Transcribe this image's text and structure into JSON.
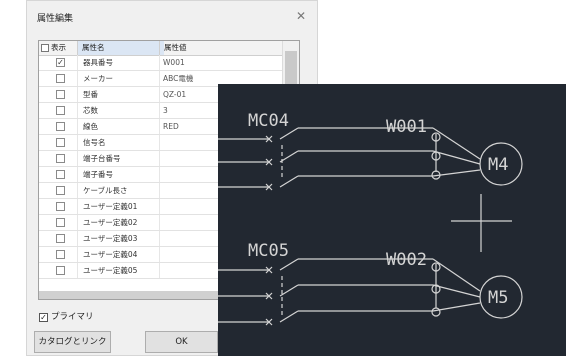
{
  "dialog": {
    "title": "属性編集",
    "close_glyph": "✕",
    "table": {
      "columns": [
        "表示",
        "属性名",
        "属性値"
      ],
      "rows": [
        {
          "checked": true,
          "name": "器具番号",
          "value": "W001"
        },
        {
          "checked": false,
          "name": "メーカー",
          "value": "ABC電機"
        },
        {
          "checked": false,
          "name": "型番",
          "value": "QZ-01"
        },
        {
          "checked": false,
          "name": "芯数",
          "value": "3"
        },
        {
          "checked": false,
          "name": "線色",
          "value": "RED"
        },
        {
          "checked": false,
          "name": "信号名",
          "value": ""
        },
        {
          "checked": false,
          "name": "端子台番号",
          "value": ""
        },
        {
          "checked": false,
          "name": "端子番号",
          "value": ""
        },
        {
          "checked": false,
          "name": "ケーブル長さ",
          "value": ""
        },
        {
          "checked": false,
          "name": "ユーザー定義01",
          "value": ""
        },
        {
          "checked": false,
          "name": "ユーザー定義02",
          "value": ""
        },
        {
          "checked": false,
          "name": "ユーザー定義03",
          "value": ""
        },
        {
          "checked": false,
          "name": "ユーザー定義04",
          "value": ""
        },
        {
          "checked": false,
          "name": "ユーザー定義05",
          "value": ""
        }
      ]
    },
    "primary_label": "プライマリ",
    "primary_checked": true,
    "catalog_button": "カタログとリンク",
    "ok_button": "OK"
  },
  "cad": {
    "labels": {
      "mc04": "MC04",
      "w001": "W001",
      "m4": "M4",
      "mc05": "MC05",
      "w002": "W002",
      "m5": "M5"
    },
    "colors": {
      "background": "#222831",
      "lines": "#d4d4d4"
    }
  }
}
